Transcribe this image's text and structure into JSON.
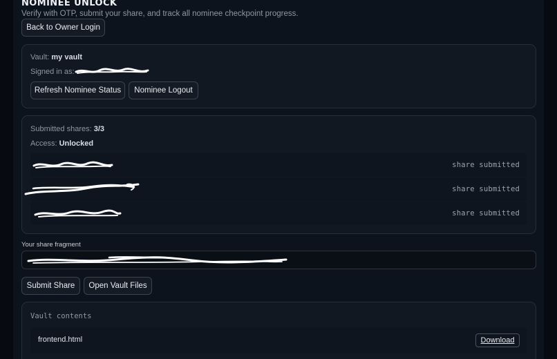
{
  "page": {
    "title": "NOMINEE UNLOCK",
    "subtitle": "Verify with OTP, submit your share, and track all nominee checkpoint progress.",
    "back_button": "Back to Owner Login"
  },
  "session": {
    "vault_label": "Vault:",
    "vault_name": "my vault",
    "signed_in_label": "Signed in as:",
    "refresh_button": "Refresh Nominee Status",
    "logout_button": "Nominee Logout"
  },
  "status": {
    "submitted_label": "Submitted shares:",
    "submitted_value": "3/3",
    "access_label": "Access:",
    "access_value": "Unlocked",
    "shares": [
      {
        "status": "share submitted"
      },
      {
        "status": "share submitted"
      },
      {
        "status": "share submitted"
      }
    ]
  },
  "fragment": {
    "label": "Your share fragment"
  },
  "actions": {
    "submit_button": "Submit Share",
    "open_button": "Open Vault Files"
  },
  "vault": {
    "title": "Vault contents",
    "files": [
      {
        "name": "frontend.html",
        "action": "Download"
      }
    ]
  }
}
